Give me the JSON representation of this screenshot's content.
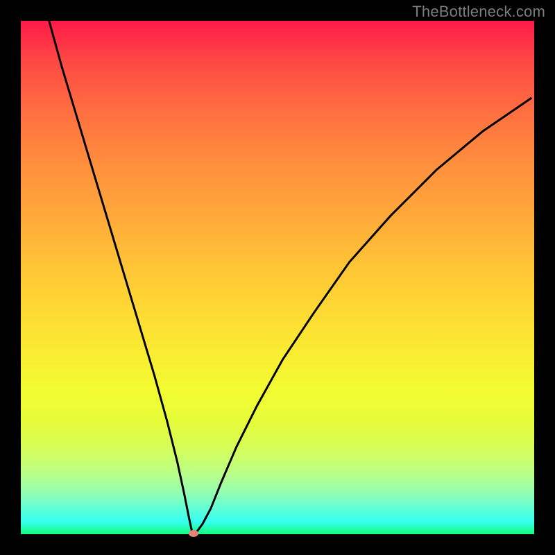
{
  "watermark": "TheBottleneck.com",
  "chart_data": {
    "type": "line",
    "title": "",
    "xlabel": "",
    "ylabel": "",
    "xlim": [
      0,
      100
    ],
    "ylim": [
      0,
      100
    ],
    "grid": false,
    "legend": false,
    "series": [
      {
        "name": "bottleneck-curve",
        "x": [
          5.5,
          8,
          11,
          14,
          17,
          20,
          23,
          26,
          28.5,
          30.5,
          31.8,
          32.8,
          33.3,
          33.55,
          34.3,
          35.4,
          37,
          39,
          42,
          46,
          51,
          57,
          64,
          72,
          81,
          90,
          99.5
        ],
        "y": [
          100,
          91,
          81,
          71,
          61,
          51,
          41,
          31,
          22,
          14,
          8,
          3,
          0.7,
          0.2,
          0.5,
          2,
          5,
          10,
          17,
          25,
          34,
          43,
          53,
          62,
          71,
          78.5,
          85
        ]
      }
    ],
    "markers": [
      {
        "name": "optimal-point",
        "x": 33.6,
        "y": 0.2,
        "color": "#e98079"
      }
    ],
    "background_gradient": {
      "top_color": "#fe1a49",
      "bottom_color": "#13fe7e",
      "description": "red-orange-yellow-green vertical gradient"
    },
    "curve_color": "#000000",
    "frame_color": "#000000"
  },
  "colors": {
    "watermark": "#7d7d7d",
    "curve": "#000000",
    "marker": "#e98079",
    "background_black": "#000000"
  }
}
